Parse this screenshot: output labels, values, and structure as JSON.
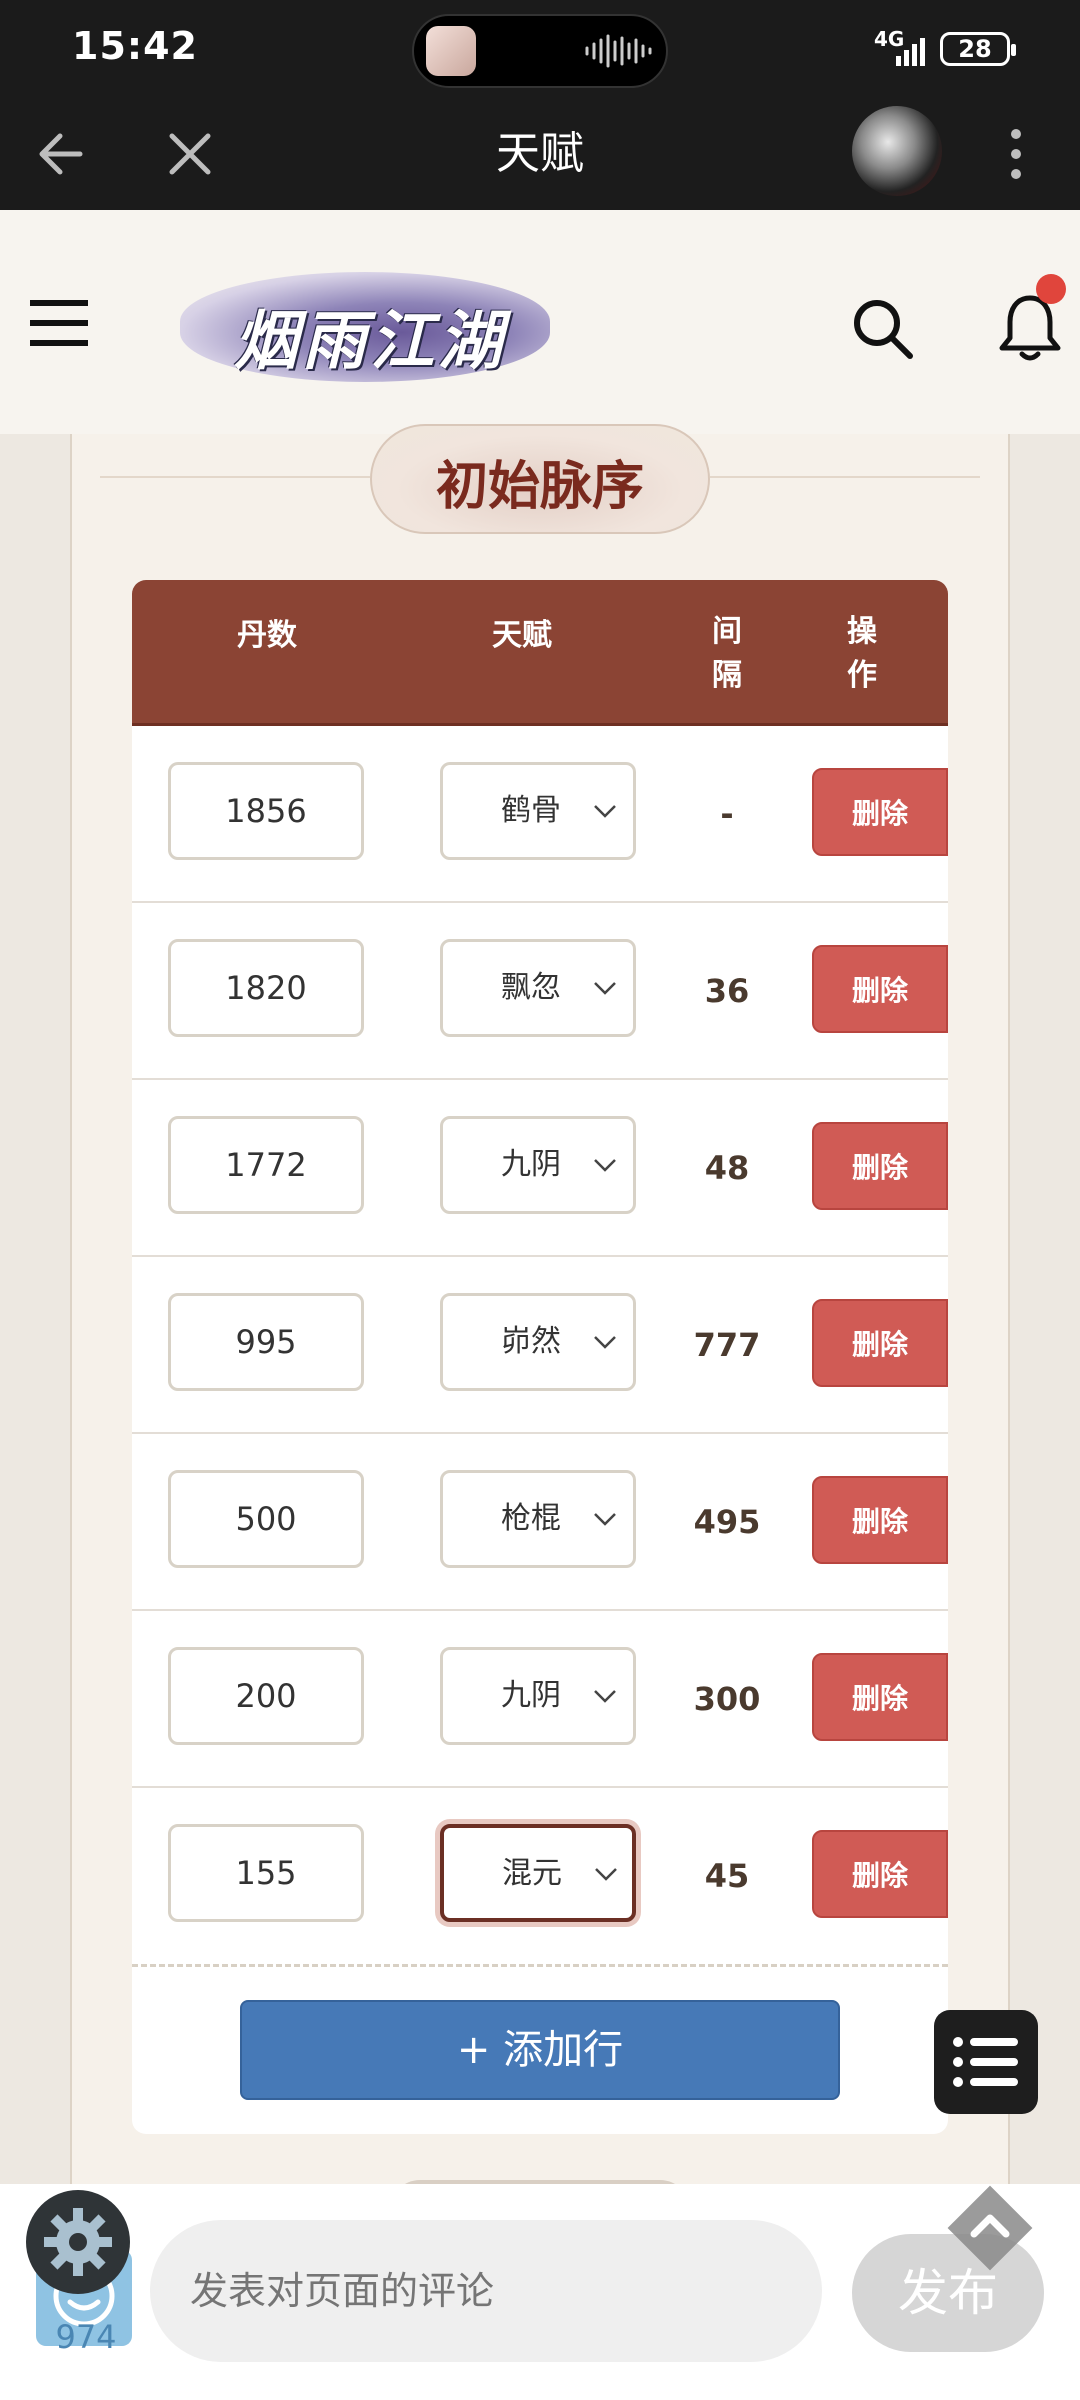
{
  "status_bar": {
    "time": "15:42",
    "network": "4G",
    "battery": "28"
  },
  "title_bar": {
    "title": "天赋"
  },
  "site": {
    "logo_text": "烟雨江湖"
  },
  "section": {
    "title": "初始脉序"
  },
  "table": {
    "headers": {
      "count": "丹数",
      "talent": "天赋",
      "interval": "间隔",
      "op": "操作"
    },
    "rows": [
      {
        "count": "1856",
        "talent": "鹤骨",
        "interval": "-",
        "action": "删除"
      },
      {
        "count": "1820",
        "talent": "飘忽",
        "interval": "36",
        "action": "删除"
      },
      {
        "count": "1772",
        "talent": "九阴",
        "interval": "48",
        "action": "删除"
      },
      {
        "count": "995",
        "talent": "峁然",
        "interval": "777",
        "action": "删除"
      },
      {
        "count": "500",
        "talent": "枪棍",
        "interval": "495",
        "action": "删除"
      },
      {
        "count": "200",
        "talent": "九阴",
        "interval": "300",
        "action": "删除"
      },
      {
        "count": "155",
        "talent": "混元",
        "interval": "45",
        "action": "删除"
      }
    ],
    "add_row_label": "+ 添加行"
  },
  "bottom_bar": {
    "comment_placeholder": "发表对页面的评论",
    "publish_label": "发布",
    "count": "974"
  },
  "colors": {
    "header": "#8b4434",
    "delete": "#d05b55",
    "add": "#4679b7",
    "focus": "#6b2f24"
  }
}
